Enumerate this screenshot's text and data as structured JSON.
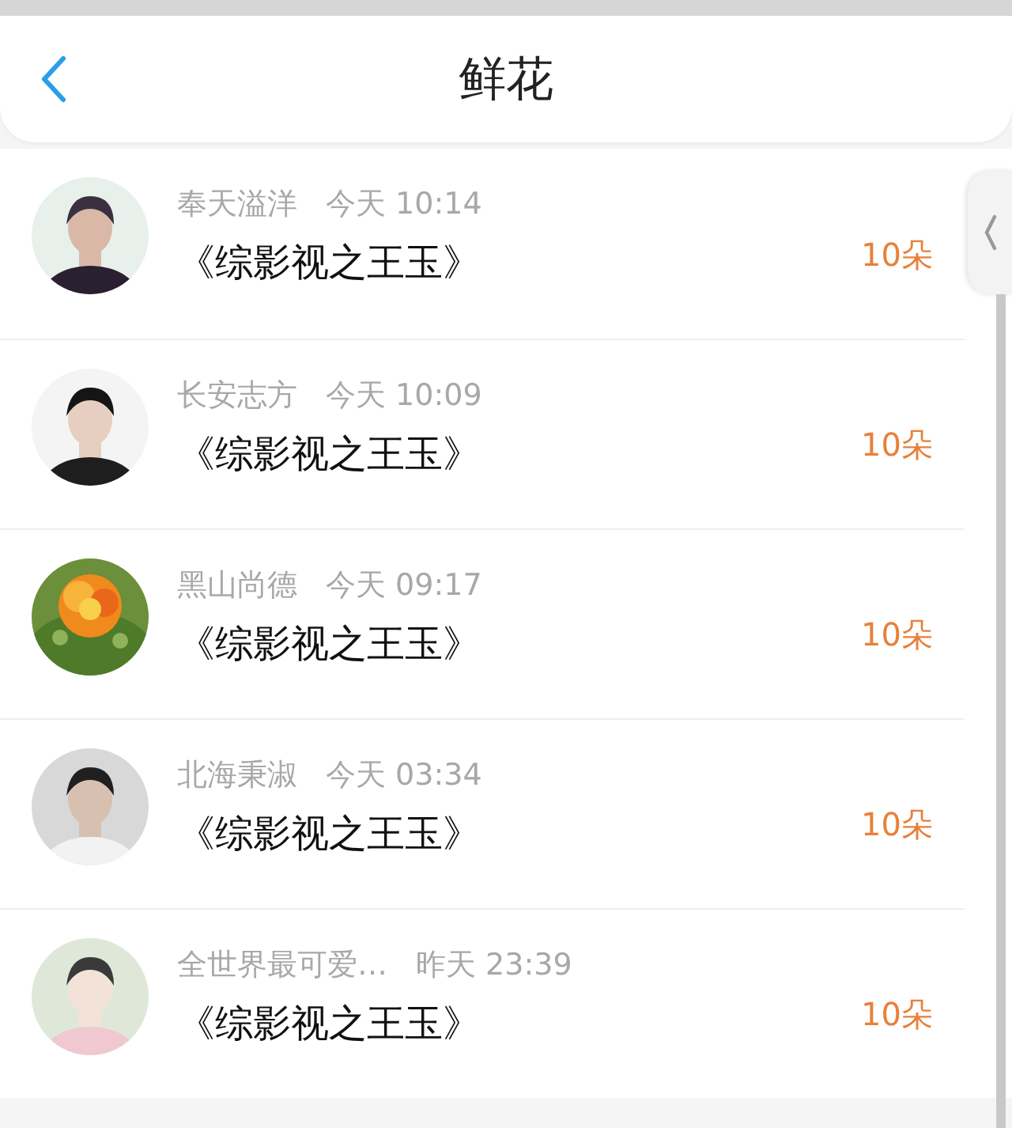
{
  "header": {
    "title": "鲜花"
  },
  "rows": [
    {
      "name": "奉天溢洋",
      "time": "今天 10:14",
      "work": "《综影视之王玉》",
      "amount": "10朵"
    },
    {
      "name": "长安志方",
      "time": "今天 10:09",
      "work": "《综影视之王玉》",
      "amount": "10朵"
    },
    {
      "name": "黑山尚德",
      "time": "今天 09:17",
      "work": "《综影视之王玉》",
      "amount": "10朵"
    },
    {
      "name": "北海秉淑",
      "time": "今天 03:34",
      "work": "《综影视之王玉》",
      "amount": "10朵"
    },
    {
      "name": "全世界最可爱…",
      "time": "昨天 23:39",
      "work": "《综影视之王玉》",
      "amount": "10朵"
    }
  ]
}
